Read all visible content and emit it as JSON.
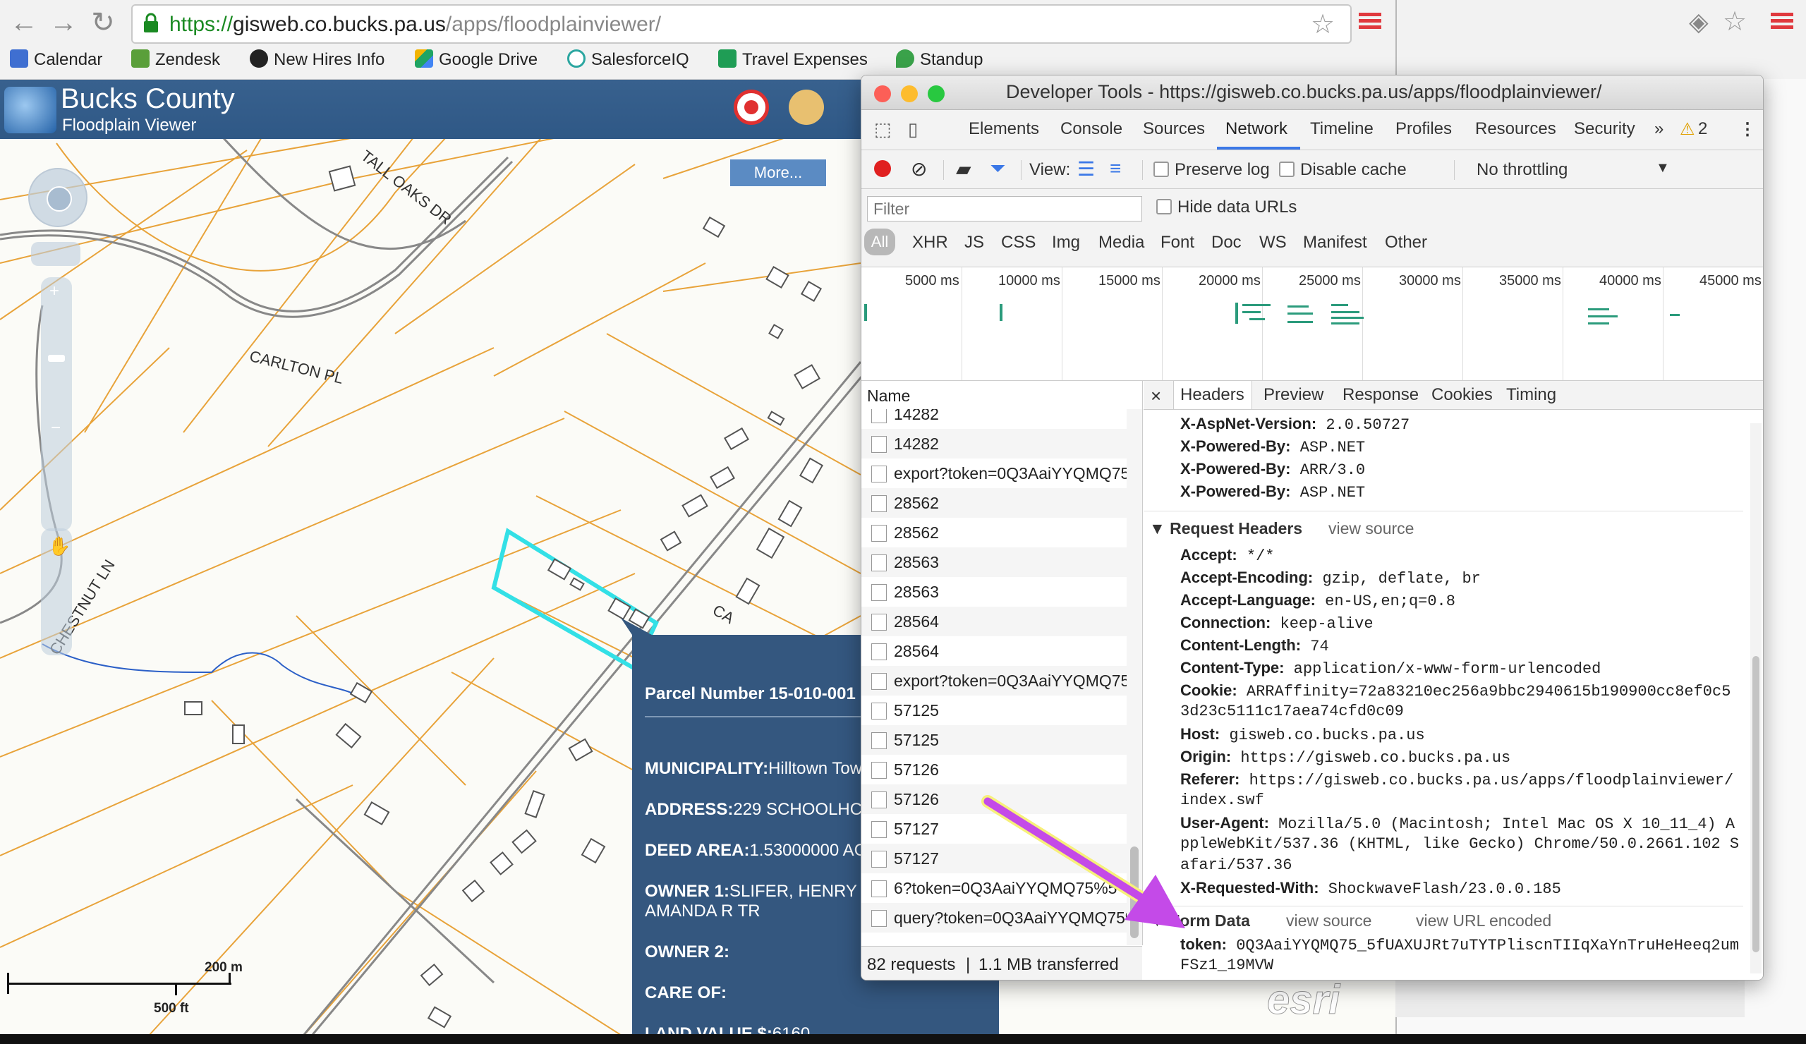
{
  "browser": {
    "url_scheme": "https://",
    "url_host": "gisweb.co.bucks.pa.us",
    "url_path": "/apps/floodplainviewer/",
    "bookmarks": [
      {
        "label": "Calendar",
        "color": "#3f6fd1"
      },
      {
        "label": "Zendesk",
        "color": "#5a9f3a"
      },
      {
        "label": "New Hires Info",
        "color": "#222222"
      },
      {
        "label": "Google Drive",
        "color": "#f2b400"
      },
      {
        "label": "SalesforceIQ",
        "color": "#2ba6a0"
      },
      {
        "label": "Travel Expenses",
        "color": "#1f9d55"
      },
      {
        "label": "Standup",
        "color": "#3aa24a"
      }
    ]
  },
  "app": {
    "title": "Bucks County",
    "subtitle": "Floodplain Viewer",
    "more_label": "More..."
  },
  "map": {
    "streets": [
      "TALL OAKS DR",
      "CARLTON PL",
      "CHESTNUT LN"
    ],
    "scale_m": "200 m",
    "scale_ft": "500 ft",
    "popup": {
      "parcel": "Parcel Number 15-010-001",
      "municipality_label": "MUNICIPALITY:",
      "municipality_value": "Hilltown Tow",
      "address_label": "ADDRESS:",
      "address_value": "229  SCHOOLHC",
      "deed_label": "DEED AREA:",
      "deed_value": "1.53000000 AC",
      "owner1_label": "OWNER 1:",
      "owner1_value": "SLIFER, HENRY",
      "owner1_value2": "AMANDA R TR",
      "owner2_label": "OWNER 2:",
      "careof_label": "CARE OF:",
      "landvalue_label": "LAND VALUE $:",
      "landvalue_value": "6160"
    }
  },
  "devtools": {
    "title": "Developer Tools - https://gisweb.co.bucks.pa.us/apps/floodplainviewer/",
    "tabs": [
      "Elements",
      "Console",
      "Sources",
      "Network",
      "Timeline",
      "Profiles",
      "Resources",
      "Security"
    ],
    "active_tab": "Network",
    "more_tabs": "»",
    "warning_count": "2",
    "toolbar": {
      "view_label": "View:",
      "preserve_log": "Preserve log",
      "disable_cache": "Disable cache",
      "throttling": "No throttling"
    },
    "filter_placeholder": "Filter",
    "hide_data_urls": "Hide data URLs",
    "filter_types": [
      "All",
      "XHR",
      "JS",
      "CSS",
      "Img",
      "Media",
      "Font",
      "Doc",
      "WS",
      "Manifest",
      "Other"
    ],
    "timeline_ticks": [
      "5000 ms",
      "10000 ms",
      "15000 ms",
      "20000 ms",
      "25000 ms",
      "30000 ms",
      "35000 ms",
      "40000 ms",
      "45000 ms"
    ],
    "list_header": "Name",
    "requests": [
      "14282",
      "14282",
      "export?token=0Q3AaiYYQMQ75%",
      "28562",
      "28562",
      "28563",
      "28563",
      "28564",
      "28564",
      "export?token=0Q3AaiYYQMQ75%",
      "57125",
      "57125",
      "57126",
      "57126",
      "57127",
      "57127",
      "6?token=0Q3AaiYYQMQ75%5",
      "query?token=0Q3AaiYYQMQ75%"
    ],
    "status_requests": "82 requests",
    "status_separator": "|",
    "status_transferred": "1.1 MB transferred",
    "detail_tabs": [
      "Headers",
      "Preview",
      "Response",
      "Cookies",
      "Timing"
    ],
    "detail_close": "×",
    "response_headers": [
      {
        "k": "X-AspNet-Version:",
        "v": "2.0.50727"
      },
      {
        "k": "X-Powered-By:",
        "v": "ASP.NET"
      },
      {
        "k": "X-Powered-By:",
        "v": "ARR/3.0"
      },
      {
        "k": "X-Powered-By:",
        "v": "ASP.NET"
      }
    ],
    "request_headers_title": "Request Headers",
    "view_source": "view source",
    "request_headers": [
      {
        "k": "Accept:",
        "v": "*/*"
      },
      {
        "k": "Accept-Encoding:",
        "v": "gzip, deflate, br"
      },
      {
        "k": "Accept-Language:",
        "v": "en-US,en;q=0.8"
      },
      {
        "k": "Connection:",
        "v": "keep-alive"
      },
      {
        "k": "Content-Length:",
        "v": "74"
      },
      {
        "k": "Content-Type:",
        "v": "application/x-www-form-urlencoded"
      },
      {
        "k": "Cookie:",
        "v": "ARRAffinity=72a83210ec256a9bbc2940615b190900cc8ef0c5",
        "v2": "3d23c5111c17aea74cfd0c09"
      },
      {
        "k": "Host:",
        "v": "gisweb.co.bucks.pa.us"
      },
      {
        "k": "Origin:",
        "v": "https://gisweb.co.bucks.pa.us"
      },
      {
        "k": "Referer:",
        "v": "https://gisweb.co.bucks.pa.us/apps/floodplainviewer/",
        "v2": "index.swf"
      },
      {
        "k": "User-Agent:",
        "v": "Mozilla/5.0 (Macintosh; Intel Mac OS X 10_11_4) A",
        "v2": "ppleWebKit/537.36 (KHTML, like Gecko) Chrome/50.0.2661.102 S",
        "v3": "afari/537.36"
      },
      {
        "k": "X-Requested-With:",
        "v": "ShockwaveFlash/23.0.0.185"
      }
    ],
    "form_data_title": "Form Data",
    "view_url_encoded": "view URL encoded",
    "form_token_key": "token:",
    "form_token_value": "0Q3AaiYYQMQ75_5fUAXUJRt7uTYTPliscnTIIqXaYnTruHeHeeq2um",
    "form_token_value2": "FSz1_19MVW"
  },
  "colors": {
    "accent_blue": "#1a73e8",
    "record_red": "#e02020",
    "parcel_highlight": "#33e0e6",
    "parcel_lines": "#e8a33a",
    "annotation_arrow": "#c44ae8"
  },
  "watermark": "esri"
}
